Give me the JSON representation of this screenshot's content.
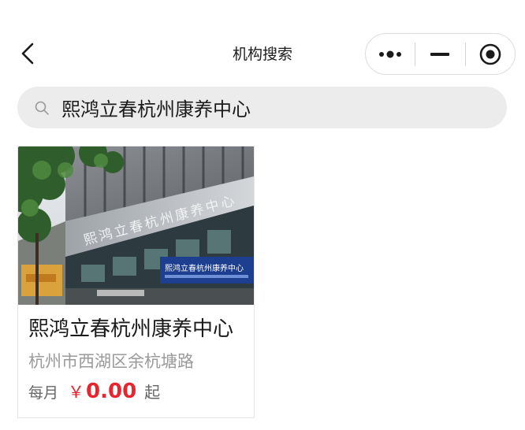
{
  "nav": {
    "title": "机构搜索",
    "back_icon": "chevron-left-icon",
    "capsule": {
      "more_icon": "more-dots-icon",
      "minimize_icon": "minimize-icon",
      "close_icon": "target-circle-icon"
    }
  },
  "search": {
    "icon": "search-icon",
    "value": "熙鸿立春杭州康养中心",
    "placeholder": ""
  },
  "results": [
    {
      "name": "熙鸿立春杭州康养中心",
      "address": "杭州市西湖区余杭塘路",
      "price_prefix": "每月",
      "currency": "￥",
      "price": "0.00",
      "price_suffix": "起",
      "image_sign_text": "熙鸿立春杭州康养中心",
      "image_panel_text": "熙鸿立春杭州康养中心"
    }
  ],
  "colors": {
    "accent_red": "#e8242f",
    "search_bg": "#ececec",
    "muted_text": "#9a9a9a"
  }
}
